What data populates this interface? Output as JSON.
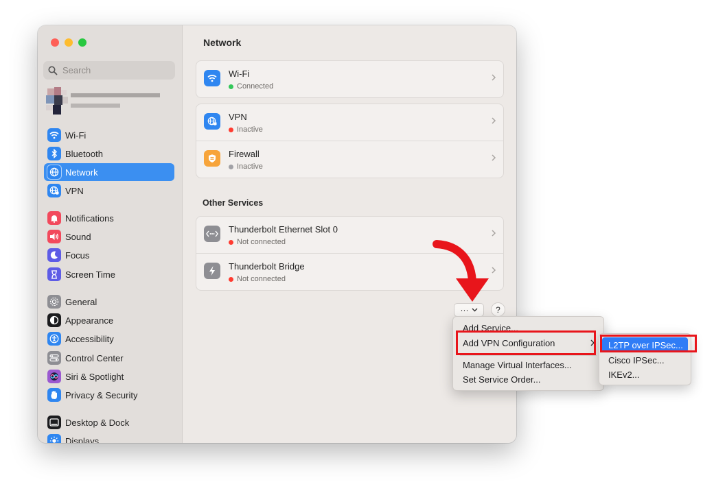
{
  "sidebar": {
    "search_placeholder": "Search",
    "items": [
      {
        "label": "Wi-Fi",
        "icon": "wifi-icon",
        "color": "#2f86f0"
      },
      {
        "label": "Bluetooth",
        "icon": "bluetooth-icon",
        "color": "#2f86f0"
      },
      {
        "label": "Network",
        "icon": "globe-icon",
        "color": "#2f86f0",
        "active": true
      },
      {
        "label": "VPN",
        "icon": "vpn-globe-icon",
        "color": "#2f86f0"
      },
      {
        "label": "Notifications",
        "icon": "bell-icon",
        "color": "#f2495c"
      },
      {
        "label": "Sound",
        "icon": "speaker-icon",
        "color": "#f2495c"
      },
      {
        "label": "Focus",
        "icon": "moon-icon",
        "color": "#5e5ce6"
      },
      {
        "label": "Screen Time",
        "icon": "hourglass-icon",
        "color": "#5e5ce6"
      },
      {
        "label": "General",
        "icon": "gear-icon",
        "color": "#8e8e93"
      },
      {
        "label": "Appearance",
        "icon": "appearance-icon",
        "color": "#1c1c1e"
      },
      {
        "label": "Accessibility",
        "icon": "accessibility-icon",
        "color": "#2f86f0"
      },
      {
        "label": "Control Center",
        "icon": "control-center-icon",
        "color": "#8e8e93"
      },
      {
        "label": "Siri & Spotlight",
        "icon": "siri-icon",
        "color": "#9b59d0"
      },
      {
        "label": "Privacy & Security",
        "icon": "hand-icon",
        "color": "#2f86f0"
      },
      {
        "label": "Desktop & Dock",
        "icon": "dock-icon",
        "color": "#1c1c1e"
      },
      {
        "label": "Displays",
        "icon": "sun-icon",
        "color": "#2f86f0"
      }
    ]
  },
  "main": {
    "title": "Network",
    "services": [
      {
        "name": "Wi-Fi",
        "status": "Connected",
        "status_color": "#34c759",
        "icon": "wifi-icon",
        "icon_color": "#2f86f0"
      },
      {
        "name": "VPN",
        "status": "Inactive",
        "status_color": "#ff3b30",
        "icon": "vpn-globe-icon",
        "icon_color": "#2f86f0"
      },
      {
        "name": "Firewall",
        "status": "Inactive",
        "status_color": "#a1a1a6",
        "icon": "firewall-icon",
        "icon_color": "#f7a43a"
      }
    ],
    "other_services_title": "Other Services",
    "other_services": [
      {
        "name": "Thunderbolt Ethernet Slot 0",
        "status": "Not connected",
        "status_color": "#ff3b30",
        "icon": "ethernet-icon",
        "icon_color": "#8e8e93"
      },
      {
        "name": "Thunderbolt Bridge",
        "status": "Not connected",
        "status_color": "#ff3b30",
        "icon": "thunderbolt-icon",
        "icon_color": "#8e8e93"
      }
    ],
    "more_button": "···",
    "help_button": "?"
  },
  "action_menu": {
    "items": [
      "Add Service...",
      "Add VPN Configuration",
      "Manage Virtual Interfaces...",
      "Set Service Order..."
    ]
  },
  "vpn_submenu": {
    "items": [
      "L2TP over IPSec...",
      "Cisco IPSec...",
      "IKEv2..."
    ],
    "highlight_color": "#2f7cf6"
  },
  "annotation": {
    "highlight_color": "#e8151b"
  }
}
